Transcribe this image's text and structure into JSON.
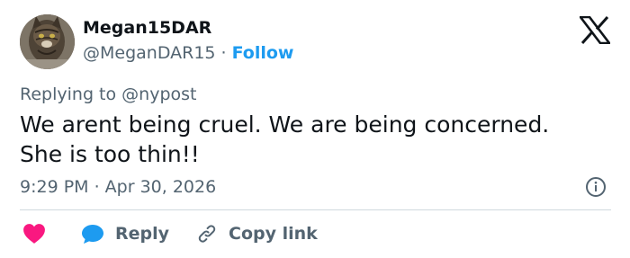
{
  "author": {
    "display_name": "Megan15DAR",
    "handle": "@MeganDAR15",
    "separator": "·",
    "follow_label": "Follow"
  },
  "tweet": {
    "replying_to": "Replying to @nypost",
    "text_line1": "We arent being cruel. We are being concerned.",
    "text_line2": "She is too thin!!",
    "timestamp": "9:29 PM · Apr 30, 2026"
  },
  "actions": {
    "reply_label": "Reply",
    "copy_link_label": "Copy link"
  },
  "icons": {
    "logo": "x-logo-icon",
    "info": "info-icon",
    "like": "heart-icon",
    "reply": "speech-bubble-icon",
    "copy_link": "link-icon"
  },
  "colors": {
    "accent": "#1d9bf0",
    "like": "#f91880",
    "secondary_text": "#536471",
    "primary_text": "#0f1419"
  }
}
